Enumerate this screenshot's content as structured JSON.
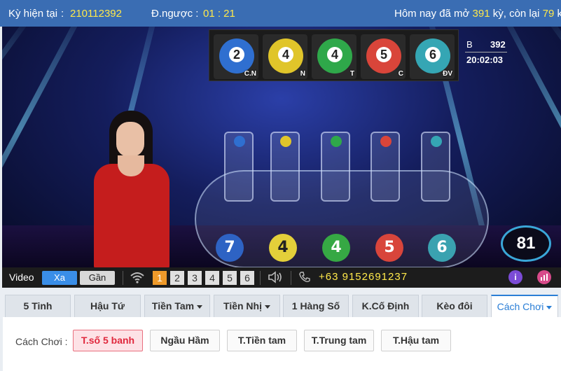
{
  "topbar": {
    "current_label": "Kỳ hiện tại",
    "current_sep": ":",
    "current_value": "210112392",
    "countdown_label": "Đ.ngược :",
    "countdown_value": "01 : 21",
    "today_prefix": "Hôm nay đã mở",
    "today_opened": "391",
    "today_middle": "kỳ, còn lại",
    "today_remaining": "79",
    "today_suffix": "kỳ"
  },
  "video": {
    "panel_balls": [
      {
        "number": "2",
        "label": "C.N",
        "color": "#2f6fd0"
      },
      {
        "number": "4",
        "label": "N",
        "color": "#e0c52a"
      },
      {
        "number": "4",
        "label": "T",
        "color": "#2fa84a"
      },
      {
        "number": "5",
        "label": "C",
        "color": "#d9453a"
      },
      {
        "number": "6",
        "label": "ĐV",
        "color": "#35a6b4"
      }
    ],
    "clock_letter": "B",
    "clock_number": "392",
    "clock_time": "20:02:03",
    "result_balls": [
      {
        "number": "7",
        "color": "#2e63c4"
      },
      {
        "number": "4",
        "color": "#e3cf3a"
      },
      {
        "number": "4",
        "color": "#36a844"
      },
      {
        "number": "5",
        "color": "#d8453b"
      },
      {
        "number": "6",
        "color": "#3aa2b0"
      }
    ],
    "counter": "81"
  },
  "controls": {
    "video_label": "Video",
    "far_label": "Xa",
    "near_label": "Gần",
    "cameras": [
      "1",
      "2",
      "3",
      "4",
      "5",
      "6"
    ],
    "active_camera": "1",
    "phone": "+63 9152691237",
    "info_icon_text": "i"
  },
  "tabs": [
    {
      "label": "5 Tinh"
    },
    {
      "label": "Hậu Tứ"
    },
    {
      "label": "Tiền Tam"
    },
    {
      "label": "Tiền Nhị"
    },
    {
      "label": "1 Hàng Số"
    },
    {
      "label": "K.Cố Định"
    },
    {
      "label": "Kèo đôi"
    },
    {
      "label": "Cách Chơi"
    }
  ],
  "play": {
    "label": "Cách Chơi :",
    "options": [
      "T.số 5 banh",
      "Ngầu Hầm",
      "T.Tiền tam",
      "T.Trung tam",
      "T.Hậu tam"
    ],
    "selected": "T.số 5 banh"
  },
  "colors": {
    "topbar": "#3a6db3",
    "highlight": "#ffe94a",
    "accent": "#2a7ed6",
    "selected_option": "#e0283d"
  }
}
